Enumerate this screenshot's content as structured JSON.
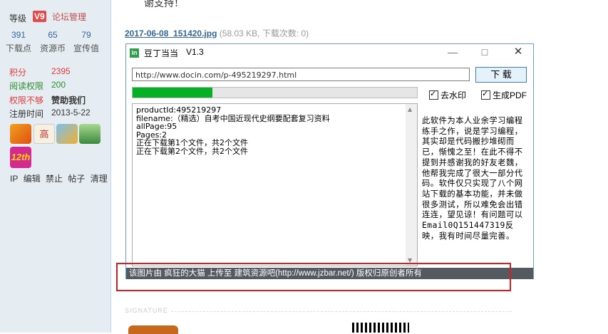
{
  "sidebar": {
    "level_label": "等级",
    "level_badge": "V9",
    "level_name": "论坛管理",
    "stats": [
      {
        "value": "391",
        "label": "下载点"
      },
      {
        "value": "65",
        "label": "资源币"
      },
      {
        "value": "79",
        "label": "宣传值"
      }
    ],
    "points_label": "积分",
    "points_value": "2395",
    "read_label": "阅读权限",
    "read_value": "200",
    "perm_label": "权限不够",
    "perm_value": "赞助我们",
    "reg_label": "注册时间",
    "reg_value": "2013-5-22",
    "medal_12th": "12th",
    "admin_links": [
      "IP",
      "编辑",
      "禁止",
      "帖子",
      "清理"
    ]
  },
  "post": {
    "top_text": "谢支持！",
    "attachment_name": "2017-06-08_151420.jpg",
    "attachment_meta": "(58.03 KB, 下载次数: 0)"
  },
  "app": {
    "icon_text": "in",
    "title": "豆丁当当",
    "version": "V1.3",
    "url_value": "http://www.docin.com/p-495219297.html",
    "download_label": "下 载",
    "progress": 0.28,
    "checkbox_watermark": "去水印",
    "checkbox_pdf": "生成PDF",
    "log_lines": [
      "productId:495219297",
      "filename:（精选）自考中国近现代史纲要配套复习资料",
      "allPage:95",
      "Pages:2",
      "正在下载第1个文件，共2个文件",
      "正在下载第2个文件，共2个文件"
    ],
    "about_text": "此软件为本人业余学习编程练手之作，说是学习编程，其实却是代码搬抄堆砌而已，惭愧之至！在此不得不提到并感谢我的好友老魏，他帮我完成了很大一部分代码。软件仅只实现了八个网站下载的基本功能，并未做很多测试，所以难免会出错连连，望见谅！有问题可以Email0Q151447319反映，我有时间尽量完善。",
    "footer": "该图片由 疯狂的大猫 上传至 建筑资源吧(http://www.jzbar.net/) 版权归原创者所有"
  },
  "signature_label": "SIGNATURE",
  "colors": {
    "accent_red": "#d81e1e",
    "progress_green": "#06b025",
    "sidebar_bg": "#e5edf2",
    "link_blue": "#336699"
  }
}
